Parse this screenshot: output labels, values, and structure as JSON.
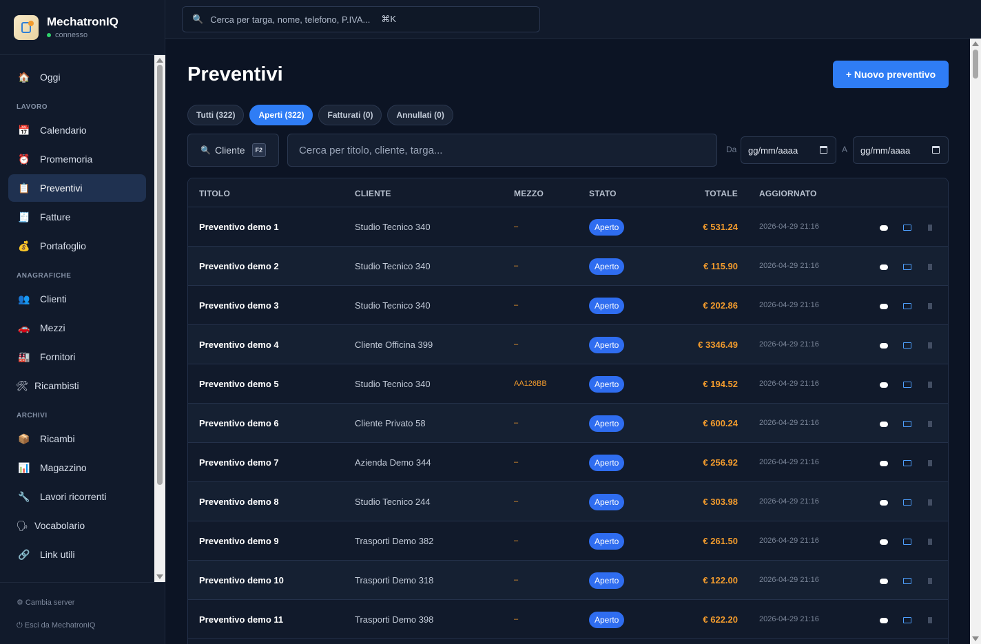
{
  "app": {
    "name": "MechatronIQ",
    "status": "connesso"
  },
  "search": {
    "placeholder": "Cerca per targa, nome, telefono, P.IVA...",
    "shortcut": "⌘K"
  },
  "sidebar": {
    "top_item": {
      "label": "Oggi",
      "icon": "house-icon"
    },
    "sections": [
      {
        "title": "LAVORO",
        "items": [
          {
            "label": "Calendario",
            "icon": "calendar-icon"
          },
          {
            "label": "Promemoria",
            "icon": "alarm-clock-icon"
          },
          {
            "label": "Preventivi",
            "icon": "document-icon",
            "active": true
          },
          {
            "label": "Fatture",
            "icon": "invoice-icon"
          },
          {
            "label": "Portafoglio",
            "icon": "money-bag-icon"
          }
        ]
      },
      {
        "title": "ANAGRAFICHE",
        "items": [
          {
            "label": "Clienti",
            "icon": "people-icon"
          },
          {
            "label": "Mezzi",
            "icon": "car-icon"
          },
          {
            "label": "Fornitori",
            "icon": "factory-icon"
          },
          {
            "label": "Ricambisti",
            "icon": "tools-icon"
          }
        ]
      },
      {
        "title": "ARCHIVI",
        "items": [
          {
            "label": "Ricambi",
            "icon": "package-icon"
          },
          {
            "label": "Magazzino",
            "icon": "bar-chart-icon"
          },
          {
            "label": "Lavori ricorrenti",
            "icon": "wrench-icon"
          },
          {
            "label": "Vocabolario",
            "icon": "speaking-head-icon"
          },
          {
            "label": "Link utili",
            "icon": "link-icon"
          }
        ]
      }
    ],
    "footer": {
      "change_server": "⚙ Cambia server",
      "logout": "⏻ Esci da MechatronIQ"
    }
  },
  "page": {
    "title": "Preventivi",
    "new_button": "+ Nuovo preventivo",
    "tabs": [
      {
        "label": "Tutti (322)",
        "active": false
      },
      {
        "label": "Aperti (322)",
        "active": true
      },
      {
        "label": "Fatturati (0)",
        "active": false
      },
      {
        "label": "Annullati (0)",
        "active": false
      }
    ],
    "filters": {
      "client_button": "Cliente",
      "client_shortcut": "F2",
      "search_placeholder": "Cerca per titolo, cliente, targa...",
      "date_from_label": "Da",
      "date_to_label": "A",
      "date_from_value": "gg/mm/aaaa",
      "date_to_value": "gg/mm/aaaa"
    }
  },
  "table": {
    "columns": [
      "TITOLO",
      "CLIENTE",
      "MEZZO",
      "STATO",
      "TOTALE",
      "AGGIORNATO"
    ],
    "rows": [
      {
        "title": "Preventivo demo 1",
        "client": "Studio Tecnico 340",
        "vehicle": "–",
        "status": "Aperto",
        "total": "€ 531.24",
        "updated": "2026-04-29 21:16"
      },
      {
        "title": "Preventivo demo 2",
        "client": "Studio Tecnico 340",
        "vehicle": "–",
        "status": "Aperto",
        "total": "€ 115.90",
        "updated": "2026-04-29 21:16"
      },
      {
        "title": "Preventivo demo 3",
        "client": "Studio Tecnico 340",
        "vehicle": "–",
        "status": "Aperto",
        "total": "€ 202.86",
        "updated": "2026-04-29 21:16"
      },
      {
        "title": "Preventivo demo 4",
        "client": "Cliente Officina 399",
        "vehicle": "–",
        "status": "Aperto",
        "total": "€ 3346.49",
        "updated": "2026-04-29 21:16"
      },
      {
        "title": "Preventivo demo 5",
        "client": "Studio Tecnico 340",
        "vehicle": "AA126BB",
        "status": "Aperto",
        "total": "€ 194.52",
        "updated": "2026-04-29 21:16"
      },
      {
        "title": "Preventivo demo 6",
        "client": "Cliente Privato 58",
        "vehicle": "–",
        "status": "Aperto",
        "total": "€ 600.24",
        "updated": "2026-04-29 21:16"
      },
      {
        "title": "Preventivo demo 7",
        "client": "Azienda Demo 344",
        "vehicle": "–",
        "status": "Aperto",
        "total": "€ 256.92",
        "updated": "2026-04-29 21:16"
      },
      {
        "title": "Preventivo demo 8",
        "client": "Studio Tecnico 244",
        "vehicle": "–",
        "status": "Aperto",
        "total": "€ 303.98",
        "updated": "2026-04-29 21:16"
      },
      {
        "title": "Preventivo demo 9",
        "client": "Trasporti Demo 382",
        "vehicle": "–",
        "status": "Aperto",
        "total": "€ 261.50",
        "updated": "2026-04-29 21:16"
      },
      {
        "title": "Preventivo demo 10",
        "client": "Trasporti Demo 318",
        "vehicle": "–",
        "status": "Aperto",
        "total": "€ 122.00",
        "updated": "2026-04-29 21:16"
      },
      {
        "title": "Preventivo demo 11",
        "client": "Trasporti Demo 398",
        "vehicle": "–",
        "status": "Aperto",
        "total": "€ 622.20",
        "updated": "2026-04-29 21:16"
      }
    ],
    "row_actions": [
      "chat-bubble-icon",
      "mail-icon",
      "trash-icon"
    ]
  },
  "colors": {
    "accent": "#2f7df5",
    "total": "#f29b2d",
    "background": "#0c1424"
  }
}
